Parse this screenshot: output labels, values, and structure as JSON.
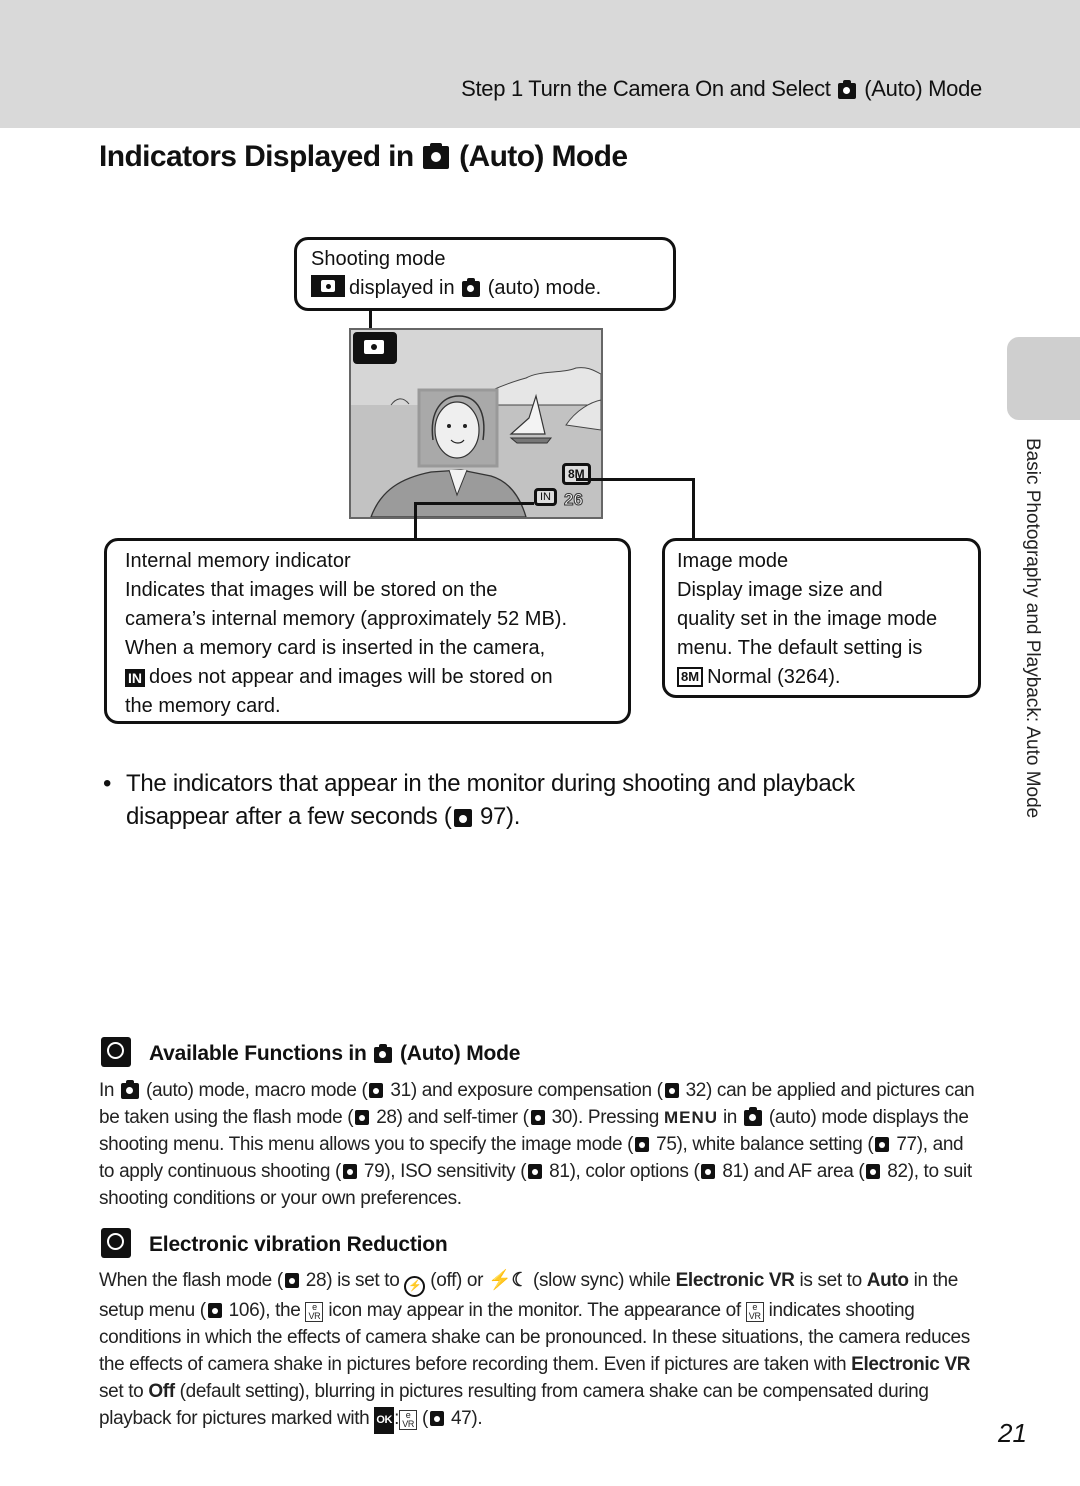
{
  "header": {
    "running_head_pre": "Step 1 Turn the Camera On and Select",
    "running_head_post": "(Auto) Mode",
    "running_head_icon": "auto-camera-icon"
  },
  "title": {
    "pre": "Indicators Displayed in",
    "post": "(Auto) Mode",
    "icon": "auto-camera-icon"
  },
  "diagram": {
    "callout_shooting": {
      "title": "Shooting mode",
      "line2_mid": "displayed in",
      "line2_post": "(auto) mode."
    },
    "lcd": {
      "image_mode_glyph": "8M",
      "memory_glyph": "IN",
      "frames_remaining": "26"
    },
    "callout_memory": {
      "title": "Internal memory indicator",
      "line1": "Indicates that images will be stored on the",
      "line2": "camera’s internal memory (approximately 52 MB).",
      "line3": "When a memory card is inserted in the camera,",
      "line4_glyph": "IN",
      "line4": "does not appear and images will be stored on",
      "line5": "the memory card."
    },
    "callout_image": {
      "title": "Image mode",
      "line1": "Display image size and",
      "line2": "quality set in the image mode",
      "line3": "menu. The default setting is",
      "line4_glyph": "8M",
      "line4": "Normal (3264)."
    }
  },
  "bullet": {
    "dot": "•",
    "line1": "The indicators that appear in the monitor during shooting and playback",
    "line2_pre": "disappear after a few seconds (",
    "line2_ref": "97",
    "line2_post": ")."
  },
  "side_tab": {
    "label": "Basic Photography and Playback: Auto Mode"
  },
  "section_available": {
    "heading_pre": "Available Functions in",
    "heading_post": "(Auto) Mode",
    "t1": "In",
    "t2": "(auto) mode, macro mode (",
    "r1": "31",
    "t3": ") and exposure compensation (",
    "r2": "32",
    "t4": ") can be applied and pictures can be taken using the flash mode (",
    "r3": "28",
    "t5": ") and self-timer (",
    "r4": "30",
    "t6": "). Pressing",
    "menu_word": "MENU",
    "t7": "in",
    "t8": "(auto) mode displays the shooting menu. This menu allows you to specify the image mode (",
    "r5": "75",
    "t9": "), white balance setting (",
    "r6": "77",
    "t10": "), and to apply continuous shooting (",
    "r7": "79",
    "t11": "), ISO sensitivity (",
    "r8": "81",
    "t12": "), color options (",
    "r9": "81",
    "t13": ") and AF area (",
    "r10": "82",
    "t14": "), to suit shooting conditions or your own preferences."
  },
  "section_vr": {
    "heading": "Electronic vibration Reduction",
    "t1": "When the flash mode (",
    "r1": "28",
    "t2": ") is set to",
    "t3": "(off) or",
    "slow_sync_glyph": "⚡☾",
    "t4": "(slow sync) while",
    "b1": "Electronic VR",
    "t5": "is set to",
    "b2": "Auto",
    "t6": "in the setup menu (",
    "r2": "106",
    "t7": "), the",
    "t8": "icon may appear in the monitor. The appearance of",
    "t9": "indicates shooting conditions in which the effects of camera shake can be pronounced. In these situations, the camera reduces the effects of camera shake in pictures before recording them. Even if pictures are taken with",
    "b3": "Electronic VR",
    "t10": "set to",
    "b4": "Off",
    "t11": "(default setting), blurring in pictures resulting from camera shake can be compensated during playback for pictures marked with",
    "ok_glyph": "OK",
    "t12": "(",
    "r3": "47",
    "t13": ")."
  },
  "page_number": "21"
}
